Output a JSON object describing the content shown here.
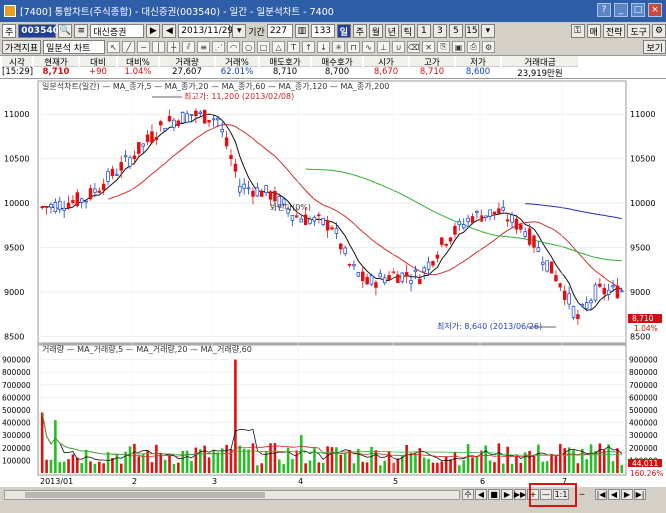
{
  "window": {
    "title": "[7400] 통합차트(주식종합) - 대신증권(003540) - 일간 - 일분석차트 - 7400"
  },
  "toolbar": {
    "market": "주",
    "code": "003540",
    "stock_name": "대신증권",
    "date": "2013/11/29",
    "period_label": "기간",
    "period_value": "227",
    "count_value": "133",
    "intervals": [
      "주",
      "월",
      "년",
      "틱",
      "1",
      "3",
      "5",
      "15"
    ],
    "right_buttons": [
      "매",
      "전략",
      "도구",
      "보기"
    ],
    "price_index": "가격지표",
    "analysis_chart": "일분석 차트"
  },
  "quote": {
    "headers": [
      "시각",
      "현재가",
      "대비",
      "대비%",
      "거래량",
      "거래%",
      "매도호가",
      "매수호가",
      "시가",
      "고가",
      "저가",
      "거래대금"
    ],
    "values": [
      "[15:29]",
      "8,710",
      "+90",
      "1.04%",
      "27,607",
      "62.01%",
      "8,710",
      "8,700",
      "8,670",
      "8,710",
      "8,600",
      "23,919만원"
    ]
  },
  "price_panel": {
    "legend": "일분석차트(일간)  — MA_종가,5 — MA_종가,20 — MA_종가,60 — MA_종가,120 — MA_종가,200",
    "high_note": "최고가: 11,200 (2013/02/08)",
    "low_note": "최저가: 8,640 (2013/06/26)",
    "mid_note": "봐란다(0%)",
    "yticks": [
      "11000",
      "10500",
      "10000",
      "9500",
      "9000",
      "8500"
    ],
    "last_price": "8,710",
    "last_pct": "1.04%"
  },
  "volume_panel": {
    "legend": "거래량  — MA_거래량,5 — MA_거래량,20 — MA_거래량,60",
    "yticks": [
      "900000",
      "800000",
      "700000",
      "600000",
      "500000",
      "400000",
      "300000",
      "200000",
      "100000"
    ],
    "last_vol": "44,011",
    "last_pct": "160.26%"
  },
  "xaxis": {
    "labels": [
      "2013/01",
      "2",
      "3",
      "4",
      "5",
      "6",
      "7"
    ]
  },
  "bottom": {
    "controls": [
      "수",
      "◀",
      "■",
      "▶",
      "▶▶",
      "+",
      "—",
      "1:1",
      "|◀",
      "◀",
      "▶",
      "▶|"
    ]
  }
}
